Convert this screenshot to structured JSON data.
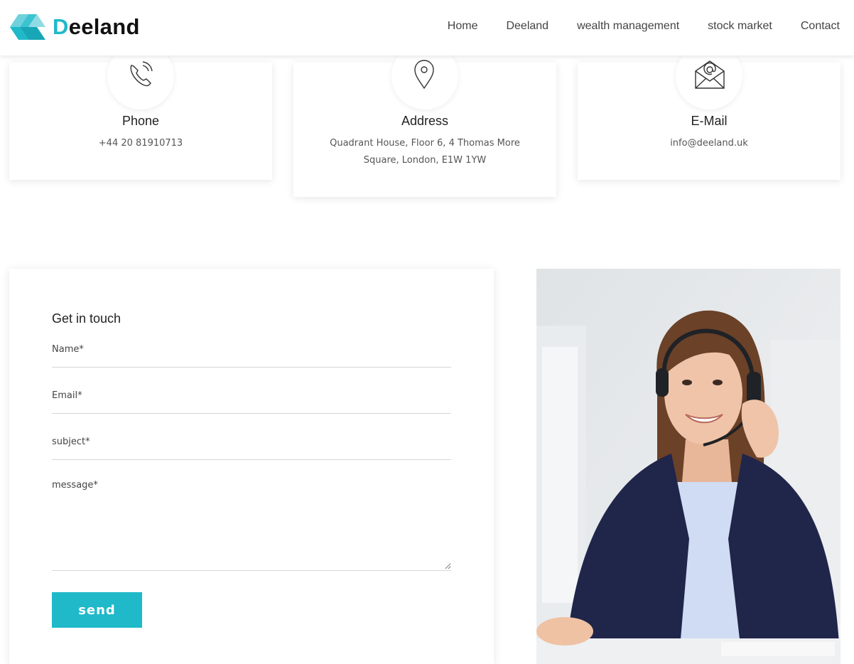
{
  "brand": {
    "first_letter": "D",
    "rest": "eeland",
    "accent_color": "#1fb9c9"
  },
  "nav": {
    "items": [
      {
        "label": "Home"
      },
      {
        "label": "Deeland"
      },
      {
        "label": "wealth management"
      },
      {
        "label": "stock market"
      },
      {
        "label": "Contact"
      }
    ]
  },
  "contact_cards": [
    {
      "icon": "phone-icon",
      "title": "Phone",
      "text": "+44 20 81910713"
    },
    {
      "icon": "location-pin-icon",
      "title": "Address",
      "text": "Quadrant House, Floor 6, 4 Thomas More Square, London, E1W 1YW"
    },
    {
      "icon": "envelope-icon",
      "title": "E-Mail",
      "text": "info@deeland.uk"
    }
  ],
  "form": {
    "title": "Get in touch",
    "name_placeholder": "Name*",
    "email_placeholder": "Email*",
    "subject_placeholder": "subject*",
    "message_placeholder": "message*",
    "send_label": "send"
  },
  "photo": {
    "subject": "support-agent-with-headset-photo"
  }
}
